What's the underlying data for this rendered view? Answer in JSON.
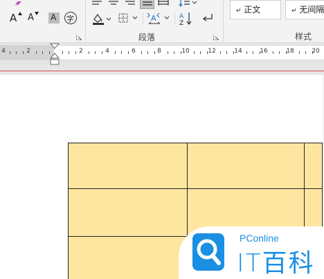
{
  "ribbon": {
    "paragraph_group_label": "段落",
    "styles_group_label": "样式",
    "styles": [
      {
        "label": "正文"
      },
      {
        "label": "无间隔"
      }
    ],
    "font_buttons": {
      "grow_font": "A",
      "shrink_font": "A",
      "char_shading": "A",
      "enclose_char": "字"
    }
  },
  "ruler": {
    "numbers": [
      "4",
      "2",
      "2",
      "4",
      "6",
      "8",
      "10",
      "12",
      "14",
      "16",
      "18",
      "20"
    ]
  },
  "table": {
    "rows": 3,
    "cols": 3,
    "fill_color": "#ffe6a0"
  },
  "watermark": {
    "brand_en": "PConline",
    "brand_cn": "IT百科",
    "brand_color": "#1a8fe3"
  },
  "icons": [
    "clear-format-icon",
    "grow-font-icon",
    "shrink-font-icon",
    "char-shading-icon",
    "enclose-char-icon",
    "align-left-icon",
    "align-center-icon",
    "align-right-icon",
    "justify-icon",
    "distributed-icon",
    "line-spacing-icon",
    "shading-icon",
    "borders-icon",
    "text-direction-icon",
    "sort-icon",
    "paragraph-mark-icon",
    "dialog-launcher-icon"
  ]
}
